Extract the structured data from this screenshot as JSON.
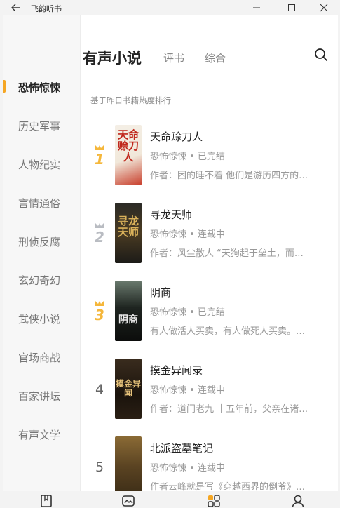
{
  "window": {
    "title": "飞韵听书"
  },
  "tabs": [
    {
      "label": "有声小说",
      "active": true
    },
    {
      "label": "评书",
      "active": false
    },
    {
      "label": "综合",
      "active": false
    }
  ],
  "sidebar": {
    "items": [
      "恐怖惊悚",
      "历史军事",
      "人物纪实",
      "言情通俗",
      "刑侦反腐",
      "玄幻奇幻",
      "武侠小说",
      "官场商战",
      "百家讲坛",
      "有声文学"
    ],
    "active_index": 0
  },
  "ranking_hint": "基于昨日书籍热度排行",
  "books": [
    {
      "rank": "1",
      "title": "天命赊刀人",
      "meta": "恐怖惊悚 • 已完结",
      "desc": "作者：困的睡不着 他们是游历四方的…",
      "cover_text": "天命赊刀人"
    },
    {
      "rank": "2",
      "title": "寻龙天师",
      "meta": "恐怖惊悚 • 连载中",
      "desc": "作者：风尘散人 “天狗起于垒土，而…",
      "cover_text": "寻龙天师"
    },
    {
      "rank": "3",
      "title": "阴商",
      "meta": "恐怖惊悚 • 已完结",
      "desc": "有人做活人买卖，有人做死人买卖。…",
      "cover_text": "阴商"
    },
    {
      "rank": "4",
      "title": "摸金异闻录",
      "meta": "恐怖惊悚 • 连载中",
      "desc": "作者：道门老九 十五年前，父亲在诸…",
      "cover_text": "摸金异闻"
    },
    {
      "rank": "5",
      "title": "北派盗墓笔记",
      "meta": "恐怖惊悚 • 连载中",
      "desc": "作者云峰就是写《穿越西界的倒爷》…",
      "cover_text": ""
    }
  ],
  "colors": {
    "accent": "#f5a623",
    "gold": "#f5b73b",
    "silver": "#b9bcc2"
  }
}
